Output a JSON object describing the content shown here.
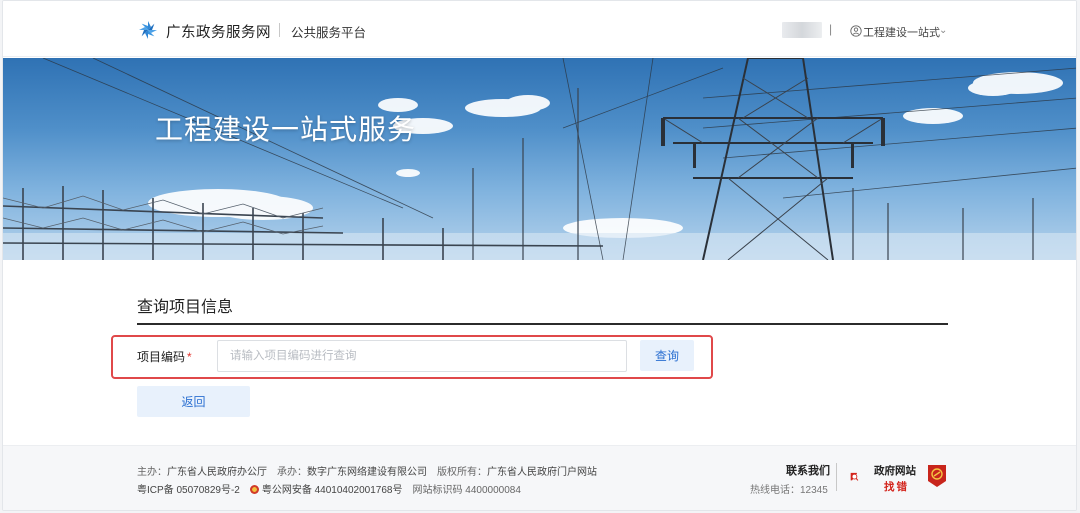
{
  "header": {
    "site_name": "广东政务服务网",
    "platform": "公共服务平台",
    "separator": "|",
    "user_menu_label": "工程建设一站式",
    "chevron": "⌄"
  },
  "banner": {
    "title": "工程建设一站式服务"
  },
  "form": {
    "section_title": "查询项目信息",
    "field_label": "项目编码",
    "required_mark": "*",
    "input_placeholder": "请输入项目编码进行查询",
    "input_value": "",
    "query_button": "查询",
    "back_button": "返回"
  },
  "footer": {
    "host_label": "主办：",
    "host": "广东省人民政府办公厅",
    "organizer_label": "承办：",
    "organizer": "数字广东网络建设有限公司",
    "copyright_label": "版权所有：",
    "copyright": "广东省人民政府门户网站",
    "icp": "粤ICP备 05070829号-2",
    "police": "粤公网安备 44010402001768号",
    "site_code": "网站标识码 4400000084",
    "contact_title": "联系我们",
    "hotline": "热线电话：12345",
    "badge_line1": "政府网站",
    "badge_line2": "找错"
  },
  "colors": {
    "accent_blue": "#2a6fd1",
    "button_bg": "#e8f1fc",
    "highlight_red": "#e0484a",
    "required_red": "#e3352e"
  },
  "icons": {
    "logo": "guangdong-pinwheel-icon",
    "user": "user-circle-icon",
    "police": "police-emblem-icon",
    "gov_error": "magnifier-gov-icon",
    "badge": "party-emblem-icon"
  }
}
